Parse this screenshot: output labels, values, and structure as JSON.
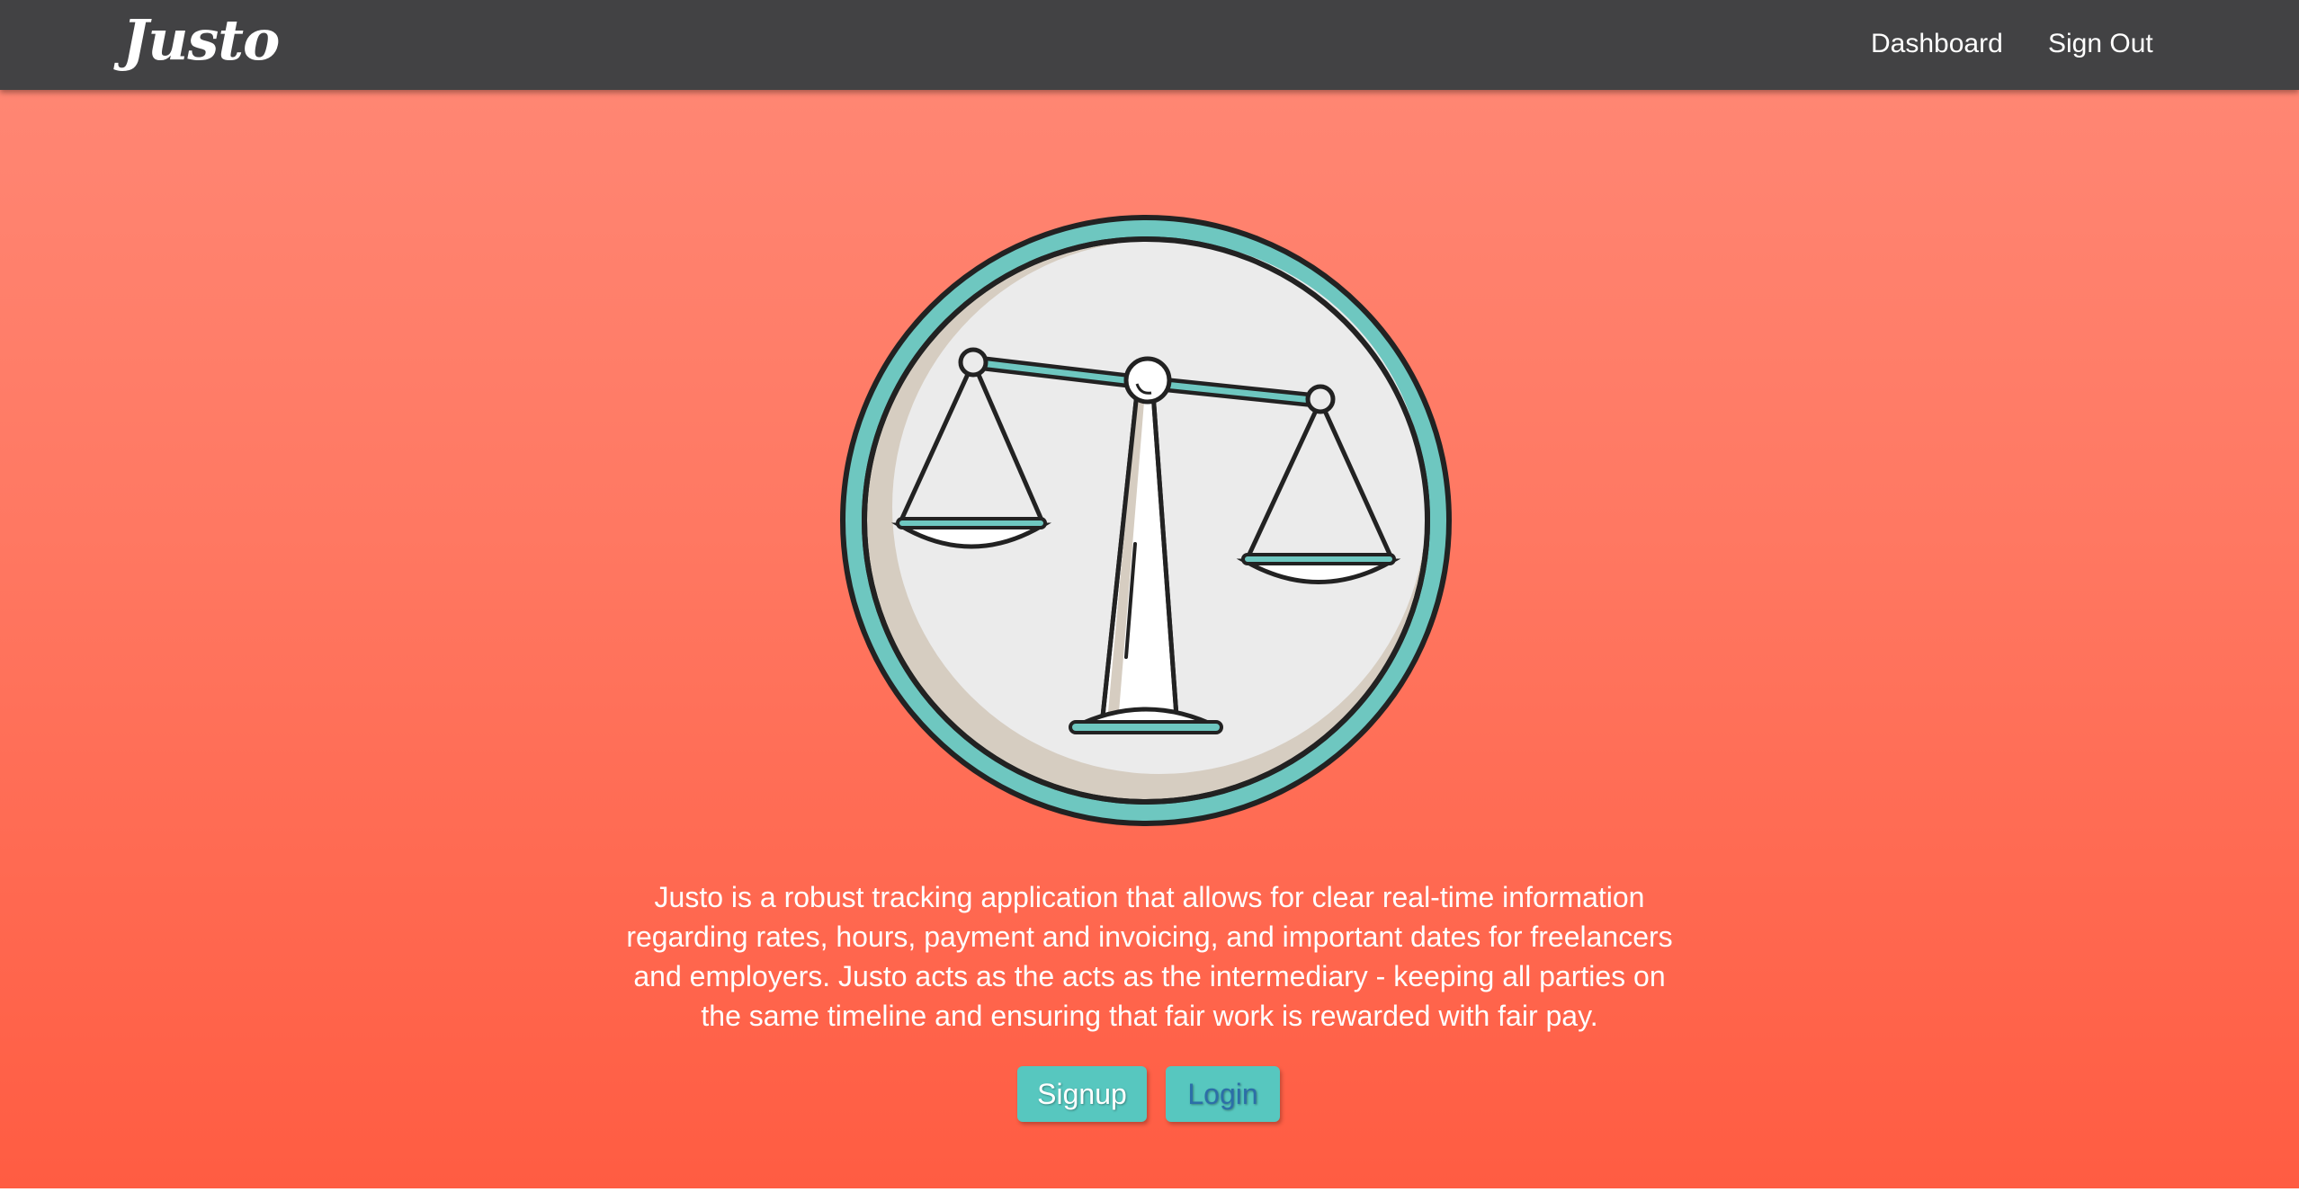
{
  "nav": {
    "brand": "Justo",
    "dashboard_label": "Dashboard",
    "signout_label": "Sign Out"
  },
  "hero": {
    "logo_icon": "scales-of-justice-icon",
    "description": "Justo is a robust tracking application that allows for clear real-time information regarding rates, hours, payment and invoicing, and important dates for freelancers and employers. Justo acts as the acts as the intermediary - keeping all parties on the same timeline and ensuring that fair work is rewarded with fair pay.",
    "signup_label": "Signup",
    "login_label": "Login"
  },
  "colors": {
    "navbar": "#424244",
    "hero_top": "#ff8673",
    "hero_bottom": "#ff5c42",
    "button_bg": "#57c7bf",
    "login_text": "#2c6ea8",
    "logo_ring": "#6ec7c0",
    "logo_face": "#ebebeb",
    "logo_shadow": "#d6cdc1"
  }
}
